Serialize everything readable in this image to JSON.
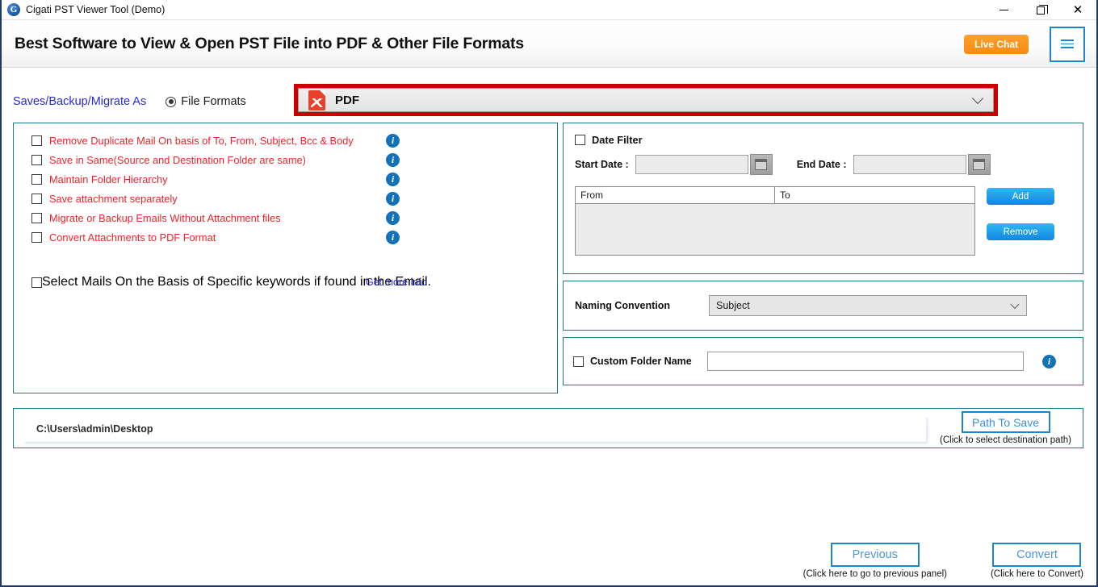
{
  "window": {
    "title": "Cigati PST Viewer Tool (Demo)",
    "app_icon": "cigati-logo-icon",
    "controls": {
      "minimize": "minimize-icon",
      "maximize": "restore-icon",
      "close": "close-icon"
    }
  },
  "banner": {
    "headline": "Best Software to View & Open PST File into PDF & Other File Formats",
    "live_chat": "Live Chat",
    "menu_icon": "hamburger-menu-icon"
  },
  "format_row": {
    "saves_label": "Saves/Backup/Migrate As",
    "radio_label": "File Formats",
    "radio_selected": true,
    "selected_format": "PDF",
    "format_icon": "pdf-file-icon",
    "highlight_color": "#cc0000"
  },
  "options": {
    "items": [
      {
        "label": "Remove Duplicate Mail On basis of To, From, Subject, Bcc & Body",
        "checked": false
      },
      {
        "label": "Save in Same(Source and Destination Folder are same)",
        "checked": false
      },
      {
        "label": "Maintain Folder Hierarchy",
        "checked": false
      },
      {
        "label": "Save attachment separately",
        "checked": false
      },
      {
        "label": "Migrate or Backup Emails Without Attachment files",
        "checked": false
      },
      {
        "label": "Convert Attachments to PDF Format",
        "checked": false
      }
    ],
    "info_glyph": "i",
    "keyword": {
      "label": "Select Mails On the Basis of Specific keywords if found in the Email.",
      "checked": false,
      "link": "Get more info"
    }
  },
  "date_filter": {
    "title": "Date Filter",
    "checked": false,
    "start_label": "Start Date :",
    "start_value": "",
    "end_label": "End Date :",
    "end_value": "",
    "calendar_icon": "calendar-icon",
    "grid": {
      "columns": [
        "From",
        "To"
      ],
      "rows": []
    },
    "add_button": "Add",
    "remove_button": "Remove"
  },
  "naming": {
    "label": "Naming Convention",
    "value": "Subject",
    "options": [
      "Subject"
    ]
  },
  "custom_folder": {
    "label": "Custom Folder Name",
    "checked": false,
    "value": "",
    "info_glyph": "i"
  },
  "path": {
    "value": "C:\\Users\\admin\\Desktop",
    "button": "Path To Save",
    "hint": "(Click to select destination path)"
  },
  "actions": {
    "previous": {
      "label": "Previous",
      "hint": "(Click here to go to previous panel)"
    },
    "convert": {
      "label": "Convert",
      "hint": "(Click here to Convert)"
    }
  },
  "colors": {
    "panel_border": "#1f7a8c",
    "option_text": "#e8252b",
    "link": "#2b2bd4",
    "accent_blue": "#1a86d0",
    "orange": "#f68b14"
  }
}
